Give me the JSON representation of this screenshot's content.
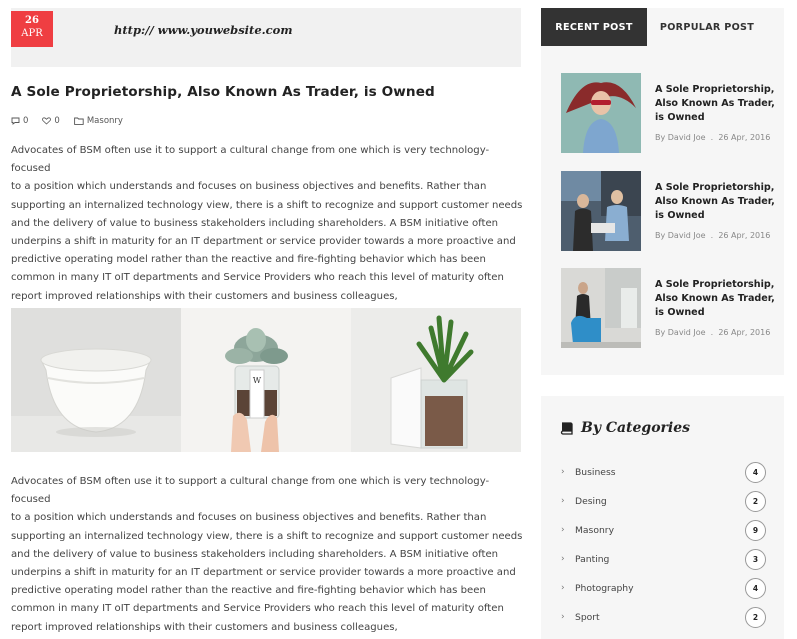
{
  "post": {
    "date": {
      "day": "26",
      "month": "APR"
    },
    "url": "http:// www.youwebsite.com",
    "title": "A Sole Proprietorship, Also Known As Trader, is Owned",
    "meta": {
      "comments": "0",
      "likes": "0",
      "category": "Masonry"
    },
    "paragraph_lines": [
      "Advocates of BSM often use it to support a cultural change from one which is very technology-focused",
      "to a position which understands and focuses on business objectives and benefits. Rather than",
      "supporting an internalized technology view, there is a shift to recognize and support customer needs",
      "and the delivery of value to business stakeholders including shareholders. A BSM initiative often",
      "underpins a shift in maturity for an IT department or service provider towards a more proactive and",
      "predictive operating model rather than the reactive and fire-fighting behavior which has been",
      "common in many IT oIT departments and Service Providers who reach this level of maturity often",
      "report improved relationships with their customers and business colleagues,"
    ],
    "gallery": [
      "white-bowl-image",
      "succulent-jar-image",
      "plant-pot-image"
    ]
  },
  "sidebar": {
    "tabs": [
      {
        "label": "RECENT POST",
        "active": true
      },
      {
        "label": "PORPULAR POST",
        "active": false
      }
    ],
    "recent_posts": [
      {
        "title": "A Sole Proprietorship, Also Known As Trader, is Owned",
        "author": "By David Joe",
        "date": "26 Apr, 2016",
        "thumb": "woman-sunglasses-image"
      },
      {
        "title": "A Sole Proprietorship, Also Known As Trader, is Owned",
        "author": "By David Joe",
        "date": "26 Apr, 2016",
        "thumb": "office-people-image"
      },
      {
        "title": "A Sole Proprietorship, Also Known As Trader, is Owned",
        "author": "By David Joe",
        "date": "26 Apr, 2016",
        "thumb": "man-blue-chair-image"
      }
    ],
    "categories_heading": "By Categories",
    "categories": [
      {
        "label": "Business",
        "count": "4"
      },
      {
        "label": "Desing",
        "count": "2"
      },
      {
        "label": "Masonry",
        "count": "9"
      },
      {
        "label": "Panting",
        "count": "3"
      },
      {
        "label": "Photography",
        "count": "4"
      },
      {
        "label": "Sport",
        "count": "2"
      }
    ]
  },
  "colors": {
    "accent": "#ef3e42",
    "tab_active": "#333333",
    "panel": "#f6f6f6"
  },
  "icons": [
    "comment-icon",
    "heart-icon",
    "folder-icon",
    "book-icon",
    "chevron-right-icon"
  ]
}
